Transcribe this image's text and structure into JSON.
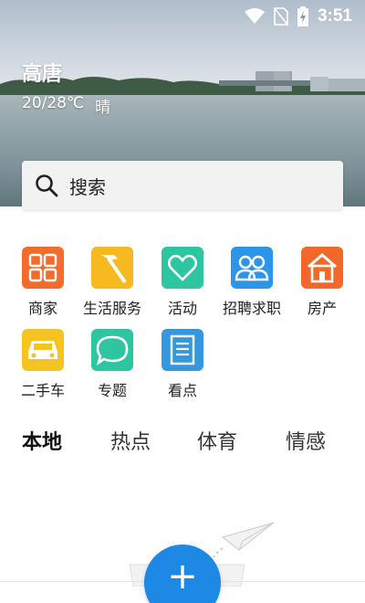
{
  "status_bar": {
    "time": "3:51",
    "icons": [
      "wifi-icon",
      "no-sim-icon",
      "battery-charging-icon"
    ]
  },
  "location": {
    "city": "高唐",
    "temperature": "20/28℃",
    "condition": "晴"
  },
  "search": {
    "label": "搜索",
    "icon": "search-icon"
  },
  "categories": [
    {
      "label": "商家",
      "icon": "grid-icon",
      "color": "#f26d2d"
    },
    {
      "label": "生活服务",
      "icon": "hammer-icon",
      "color": "#f6b91f"
    },
    {
      "label": "活动",
      "icon": "heart-icon",
      "color": "#2ec6a0"
    },
    {
      "label": "招聘求职",
      "icon": "people-icon",
      "color": "#2b95e9"
    },
    {
      "label": "房产",
      "icon": "house-icon",
      "color": "#f2672a"
    },
    {
      "label": "二手车",
      "icon": "car-icon",
      "color": "#f5c423"
    },
    {
      "label": "专题",
      "icon": "chat-bubble-icon",
      "color": "#2ec6a0"
    },
    {
      "label": "看点",
      "icon": "document-icon",
      "color": "#3498e0"
    }
  ],
  "tabs": [
    {
      "label": "本地",
      "active": true
    },
    {
      "label": "热点",
      "active": false
    },
    {
      "label": "体育",
      "active": false
    },
    {
      "label": "情感",
      "active": false
    }
  ],
  "fab": {
    "label": "+",
    "color": "#1e88e5"
  }
}
